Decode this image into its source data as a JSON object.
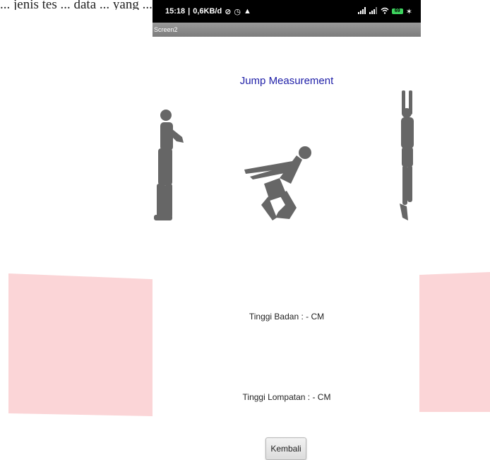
{
  "top_text": "... jenis tes ... data ... yang ... tinggi ... lompat ...",
  "status_bar": {
    "time": "15:18",
    "network_speed": "0,6KB/d",
    "battery": "69",
    "icons": [
      "mute-icon",
      "alarm-icon",
      "warning-icon",
      "signal-icon",
      "signal-icon",
      "wifi-icon",
      "battery-icon",
      "charging-icon"
    ]
  },
  "app": {
    "screen_title": "Screen2"
  },
  "main": {
    "heading": "Jump Measurement",
    "tinggi_badan_label": "Tinggi Badan :  - CM",
    "tinggi_lompatan_label": "Tinggi Lompatan :  - CM",
    "back_button": "Kembali"
  },
  "colors": {
    "heading": "#2020a8",
    "side_panel": "#fbd5d7",
    "status_bar": "#000000",
    "title_bar": "#8a8a8a"
  }
}
